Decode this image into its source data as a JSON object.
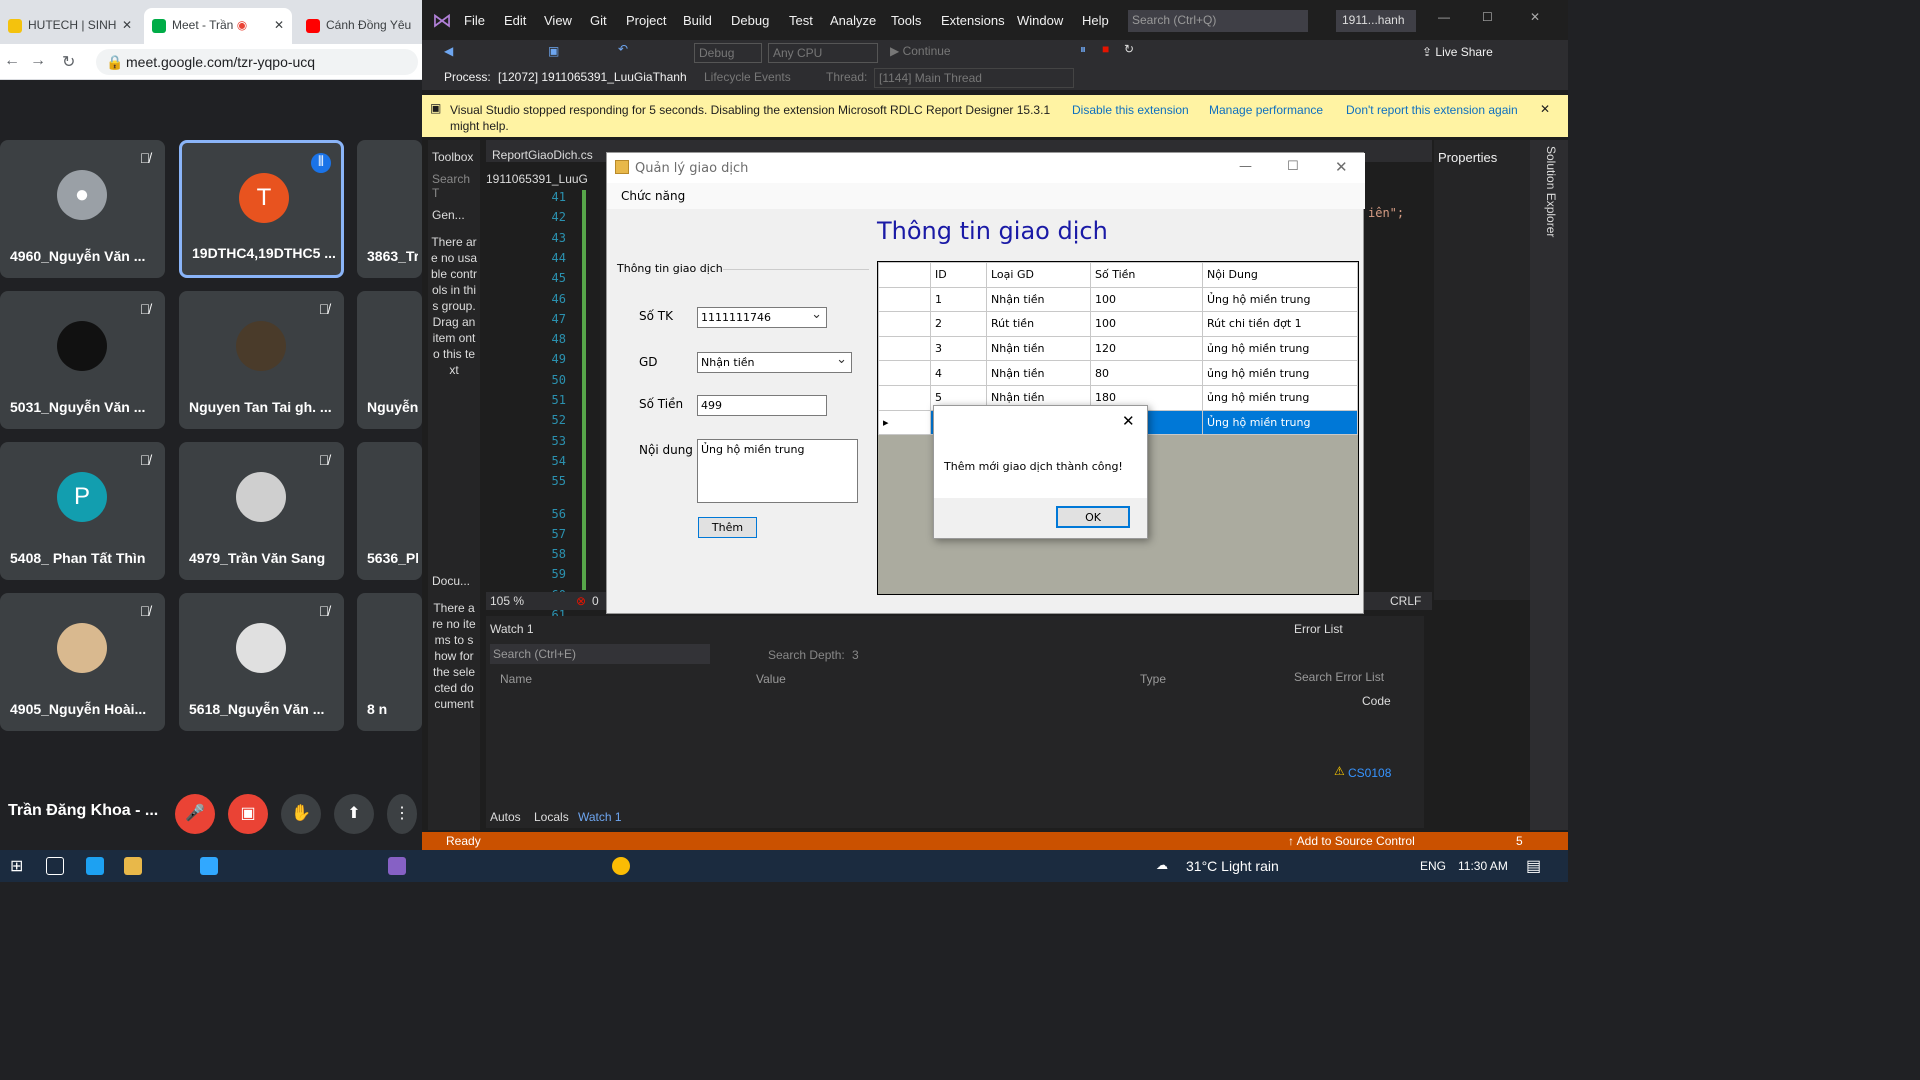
{
  "browser": {
    "tabs": [
      {
        "label": "HUTECH | SINH"
      },
      {
        "label": "Meet - Trần"
      },
      {
        "label": "Cánh Đồng Yêu"
      }
    ],
    "url": "meet.google.com/tzr-yqpo-ucq"
  },
  "meet": {
    "participants": [
      {
        "name": "4960_Nguyễn Văn ...",
        "initial": ""
      },
      {
        "name": "19DTHC4,19DTHC5 ...",
        "initial": "T"
      },
      {
        "name": "3863_Tr"
      },
      {
        "name": "5031_Nguyễn Văn ..."
      },
      {
        "name": "Nguyen Tan Tai gh. ..."
      },
      {
        "name": "Nguyễn"
      },
      {
        "name": "5408_ Phan Tất Thìn",
        "initial": "P"
      },
      {
        "name": "4979_Trần Văn Sang"
      },
      {
        "name": "5636_Ph"
      },
      {
        "name": "4905_Nguyễn Hoài..."
      },
      {
        "name": "5618_Nguyễn Văn ..."
      },
      {
        "name": "8 n"
      }
    ],
    "self_name": "Trần Đăng Khoa - ..."
  },
  "vs": {
    "menu": [
      "File",
      "Edit",
      "View",
      "Git",
      "Project",
      "Build",
      "Debug",
      "Test",
      "Analyze",
      "Tools",
      "Extensions",
      "Window",
      "Help"
    ],
    "search_placeholder": "Search (Ctrl+Q)",
    "solution_name": "1911...hanh",
    "config": "Debug",
    "platform": "Any CPU",
    "continue_label": "Continue",
    "live_share": "Live Share",
    "process_label": "Process:",
    "process_value": "[12072] 1911065391_LuuGiaThanh",
    "lifecycle": "Lifecycle Events",
    "thread_label": "Thread:",
    "thread_value": "[1144] Main Thread",
    "info_message": "Visual Studio stopped responding for 5 seconds. Disabling the extension Microsoft RDLC Report Designer 15.3.1",
    "info_message_2": "might help.",
    "info_links": [
      "Disable this extension",
      "Manage performance",
      "Don't report this extension again"
    ],
    "toolbox_title": "Toolbox",
    "toolbox_search": "Search T",
    "toolbox_group": "Gen...",
    "toolbox_empty": "There are no usable controls in this group. Drag an item onto this text",
    "doc_outline": "Docu...",
    "doc_empty": "There are no items to show for the selected document",
    "editor_tab": "ReportGiaoDich.cs",
    "editor_file": "1911065391_LuuG",
    "line_numbers": [
      "41",
      "42",
      "43",
      "44",
      "45",
      "46",
      "47",
      "48",
      "49",
      "50",
      "51",
      "52",
      "53",
      "54",
      "55",
      "56",
      "57",
      "58",
      "59",
      "60",
      "61"
    ],
    "code_snippet": "iên\";",
    "zoom": "105 %",
    "errors": "0",
    "line_ending": "CRLF",
    "properties_title": "Properties",
    "solution_explorer": "Solution Explorer",
    "watch": {
      "title": "Watch 1",
      "search": "Search (Ctrl+E)",
      "depth_label": "Search Depth:",
      "depth_value": "3",
      "columns": [
        "Name",
        "Value",
        "Type"
      ],
      "tabs": [
        "Autos",
        "Locals",
        "Watch 1"
      ]
    },
    "error_list": {
      "title": "Error List",
      "search": "Search Error List",
      "column": "Code",
      "code": "CS0108"
    },
    "status": "Ready",
    "source_control": "Add to Source Control",
    "notifications": "5"
  },
  "form": {
    "title": "Quản lý giao dịch",
    "menu": "Chức năng",
    "heading": "Thông tin giao dịch",
    "group_title": "Thông tin giao dịch",
    "labels": {
      "account": "Số TK",
      "type": "GD",
      "amount": "Số Tiền",
      "content": "Nội dung"
    },
    "values": {
      "account": "1111111746",
      "type": "Nhận tiền",
      "amount": "499",
      "content": "Ủng hộ miền trung"
    },
    "add_button": "Thêm",
    "table": {
      "columns": [
        "ID",
        "Loại GD",
        "Số Tiền",
        "Nội Dung"
      ],
      "rows": [
        {
          "id": "1",
          "type": "Nhận tiền",
          "amount": "100",
          "content": "Ủng hộ miền trung"
        },
        {
          "id": "2",
          "type": "Rút tiền",
          "amount": "100",
          "content": "Rút chi tiền đợt 1"
        },
        {
          "id": "3",
          "type": "Nhận tiền",
          "amount": "120",
          "content": "ủng hộ miền trung"
        },
        {
          "id": "4",
          "type": "Nhận tiền",
          "amount": "80",
          "content": "ủng hộ miền trung"
        },
        {
          "id": "5",
          "type": "Nhận tiền",
          "amount": "180",
          "content": "ủng hộ miền trung"
        },
        {
          "id": "",
          "type": "",
          "amount": "",
          "content": "Ủng hộ miền trung"
        }
      ]
    }
  },
  "dialog": {
    "message": "Thêm mới giao dịch thành công!",
    "ok": "OK"
  },
  "taskbar": {
    "weather": "31°C  Light rain",
    "lang": "ENG",
    "time": "11:30 AM"
  }
}
